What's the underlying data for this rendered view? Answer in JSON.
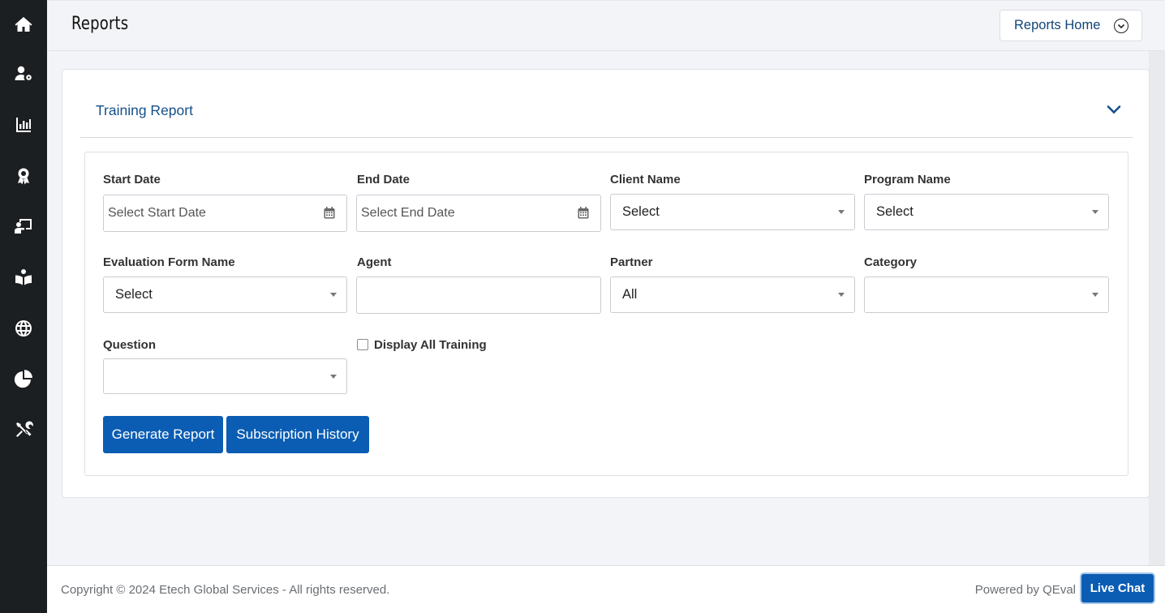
{
  "sidebar": {
    "items": [
      {
        "icon": "home-icon"
      },
      {
        "icon": "user-settings-icon"
      },
      {
        "icon": "bar-chart-icon"
      },
      {
        "icon": "award-icon"
      },
      {
        "icon": "presentation-icon"
      },
      {
        "icon": "book-reader-icon"
      },
      {
        "icon": "globe-icon"
      },
      {
        "icon": "pie-chart-icon"
      },
      {
        "icon": "tools-icon"
      }
    ]
  },
  "header": {
    "title": "Reports",
    "reports_home_label": "Reports Home"
  },
  "report": {
    "title": "Training Report",
    "fields": {
      "start_date": {
        "label": "Start Date",
        "placeholder": "Select Start Date"
      },
      "end_date": {
        "label": "End Date",
        "placeholder": "Select End Date"
      },
      "client_name": {
        "label": "Client Name",
        "value": "Select"
      },
      "program_name": {
        "label": "Program Name",
        "value": "Select"
      },
      "evaluation_form_name": {
        "label": "Evaluation Form Name",
        "value": "Select"
      },
      "agent": {
        "label": "Agent",
        "value": ""
      },
      "partner": {
        "label": "Partner",
        "value": "All"
      },
      "category": {
        "label": "Category",
        "value": ""
      },
      "question": {
        "label": "Question",
        "value": ""
      },
      "display_all_training": {
        "label": "Display All Training",
        "checked": false
      }
    },
    "buttons": {
      "generate": "Generate Report",
      "subscription_history": "Subscription History"
    }
  },
  "footer": {
    "copyright": "Copyright © 2024 Etech Global Services - All rights reserved.",
    "powered_by": "Powered by QEval",
    "live_chat": "Live Chat"
  },
  "colors": {
    "sidebar_bg": "#1c1f21",
    "primary": "#0b5db3",
    "title_blue": "#16508b"
  }
}
